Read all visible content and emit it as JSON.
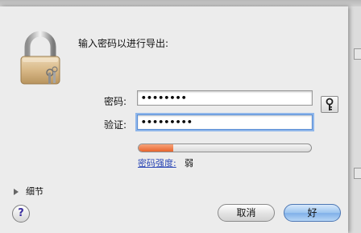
{
  "dialog": {
    "heading": "输入密码以进行导出:"
  },
  "password": {
    "label": "密码:",
    "value": "••••••••"
  },
  "verify": {
    "label": "验证:",
    "value": "•••••••••"
  },
  "strength": {
    "label": "密码强度:",
    "value": "弱",
    "level": 0.2,
    "color": "#e8652d"
  },
  "details": {
    "label": "细节"
  },
  "help": {
    "label": "?"
  },
  "buttons": {
    "cancel": "取消",
    "ok": "好"
  },
  "icons": {
    "lock": "padlock-icon",
    "key": "key-icon",
    "disclosure": "disclosure-triangle-icon"
  }
}
